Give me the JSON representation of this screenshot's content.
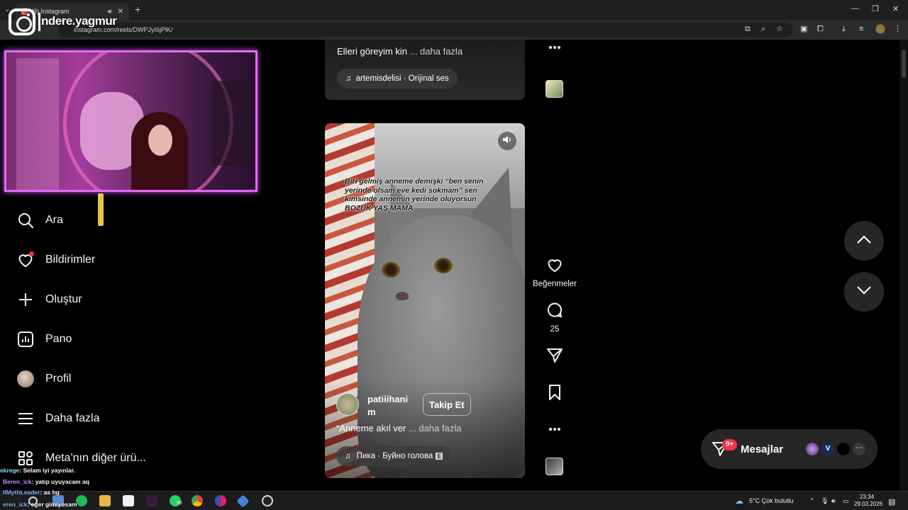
{
  "browser": {
    "tab_title": "(9) Instagram",
    "url": "instagram.com/reels/DWPJyI6jPlK/"
  },
  "overlay": {
    "streamer_name": "ndere.yagmur"
  },
  "sidebar": {
    "items": [
      {
        "label": "Ara",
        "icon": "search-icon"
      },
      {
        "label": "Bildirimler",
        "icon": "heart-icon"
      },
      {
        "label": "Oluştur",
        "icon": "plus-icon"
      },
      {
        "label": "Pano",
        "icon": "dashboard-icon"
      },
      {
        "label": "Profil",
        "icon": "avatar"
      },
      {
        "label": "Daha fazla",
        "icon": "menu-icon"
      },
      {
        "label": "Meta'nın diğer ürü...",
        "icon": "meta-apps-icon"
      }
    ]
  },
  "chat": [
    {
      "user": "ekrege",
      "msg": ": Selam iyi yayınlar."
    },
    {
      "user": "Beren_ick",
      "msg": ": yatıp uyuyacam aq"
    },
    {
      "user": "IIMythLeader",
      "msg": ": as hg"
    },
    {
      "user": "eren_ick",
      "msg": ": eğer gimiyosam"
    }
  ],
  "reel_prev": {
    "caption": "Elleri göreyim kin",
    "more": "... daha fazla",
    "audio": "artemisdelisi · Orijinal ses"
  },
  "reel": {
    "overlay_text": "Biri gelmiş anneme demişki “ben senin yerinde olsam eve kedi sokmam” sen kimsinde annemin yerinde oluyorsun BOZUK YAŞ MAMA",
    "username": "patiiihanim",
    "follow_label": "Takip Et",
    "caption": "“Anneme akıl ver",
    "more": "... daha fazla",
    "audio": "Пика · Буйно голова",
    "audio_badge": "E",
    "likes_label": "Beğenmeler",
    "comments": "25"
  },
  "messages": {
    "label": "Mesajlar",
    "badge": "9+"
  },
  "taskbar": {
    "weather": "5°C  Çok bulutlu",
    "time": "23:34",
    "date": "29.03.2026",
    "whatsapp_badge": "96"
  },
  "colors": {
    "accent_red": "#ff3040",
    "cam_border": "#e26cf5"
  }
}
